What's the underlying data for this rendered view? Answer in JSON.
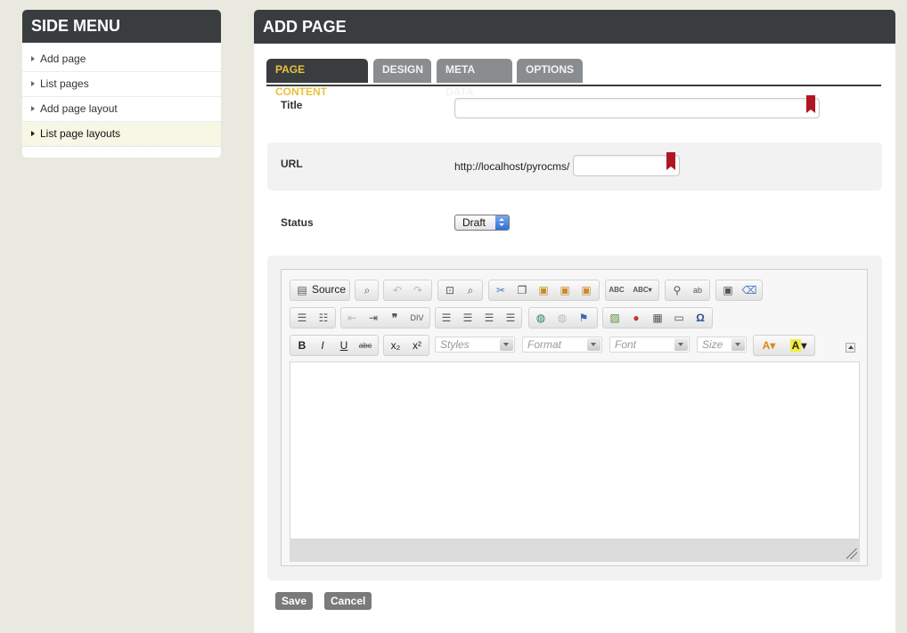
{
  "side_menu": {
    "title": "SIDE MENU",
    "items": [
      {
        "label": "Add page"
      },
      {
        "label": "List pages"
      },
      {
        "label": "Add page layout"
      },
      {
        "label": "List page layouts",
        "active": true
      }
    ]
  },
  "main": {
    "title": "ADD PAGE",
    "tabs": [
      {
        "label": "PAGE CONTENT",
        "active": true
      },
      {
        "label": "DESIGN"
      },
      {
        "label": "META DATA"
      },
      {
        "label": "OPTIONS"
      }
    ],
    "form": {
      "title_label": "Title",
      "title_value": "",
      "url_label": "URL",
      "url_prefix": "http://localhost/pyrocms/",
      "url_value": "",
      "status_label": "Status",
      "status_value": "Draft"
    },
    "editor": {
      "source_label": "Source",
      "styles_placeholder": "Styles",
      "format_placeholder": "Format",
      "font_placeholder": "Font",
      "size_placeholder": "Size"
    },
    "buttons": {
      "save": "Save",
      "cancel": "Cancel"
    }
  },
  "colors": {
    "header_bg": "#3a3d3f",
    "active_tab_text": "#e7c23d",
    "required_marker": "#b01722"
  }
}
